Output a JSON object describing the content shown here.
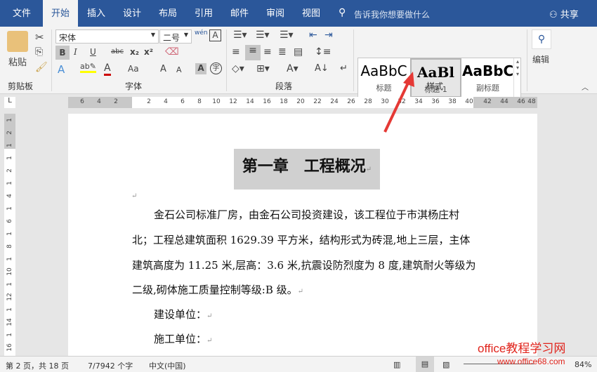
{
  "tabs": [
    "文件",
    "开始",
    "插入",
    "设计",
    "布局",
    "引用",
    "邮件",
    "审阅",
    "视图"
  ],
  "active_tab": "开始",
  "tell_me": "告诉我你想要做什么",
  "share": "共享",
  "clipboard": {
    "paste": "粘贴",
    "group": "剪贴板"
  },
  "font": {
    "name": "宋体",
    "size": "二号",
    "group": "字体",
    "bold": "B",
    "italic": "I",
    "underline": "U",
    "strike": "abc",
    "sub": "x₂",
    "sup": "x²",
    "aa": "Aa",
    "grow": "A",
    "shrink": "A",
    "shade": "A",
    "enclose": "字",
    "phonetic": "wén",
    "border": "A"
  },
  "paragraph": {
    "group": "段落"
  },
  "styles": {
    "group": "样式",
    "items": [
      {
        "preview": "AaBbC",
        "label": "标题"
      },
      {
        "preview": "AaBl",
        "label": "标题 1"
      },
      {
        "preview": "AaBbC",
        "label": "副标题"
      }
    ]
  },
  "editing": {
    "label": "编辑"
  },
  "ruler": {
    "h": [
      "6",
      "4",
      "2",
      "2",
      "4",
      "6",
      "8",
      "10",
      "12",
      "14",
      "16",
      "18",
      "20",
      "22",
      "24",
      "26",
      "28",
      "30",
      "32",
      "34",
      "36",
      "38",
      "40",
      "42",
      "44",
      "46",
      "48"
    ],
    "v": [
      "1",
      "2",
      "1",
      "1",
      "2",
      "1",
      "4",
      "1",
      "6",
      "1",
      "8",
      "1",
      "10",
      "1",
      "12",
      "1",
      "14",
      "1",
      "16"
    ]
  },
  "document": {
    "heading": "第一章　工程概况",
    "lines": [
      "金石公司标准厂房，由金石公司投资建设，该工程位于市淇杨庄村",
      "北；工程总建筑面积 1629.39 平方米，结构形式为砖混,地上三层，主体",
      "建筑高度为 11.25 米,层高：3.6 米,抗震设防烈度为 8 度,建筑耐火等级为",
      "二级,砌体施工质量控制等级:B 级。"
    ],
    "builder": "建设单位：",
    "constructor": "施工单位："
  },
  "status": {
    "page": "第 2 页，共 18 页",
    "words": "7/7942 个字",
    "lang": "中文(中国)",
    "zoom": "84%"
  },
  "watermark": {
    "title": "office教程学习网",
    "url": "www.office68.com"
  },
  "colors": {
    "brand": "#2b579a",
    "arrow": "#e53935"
  }
}
